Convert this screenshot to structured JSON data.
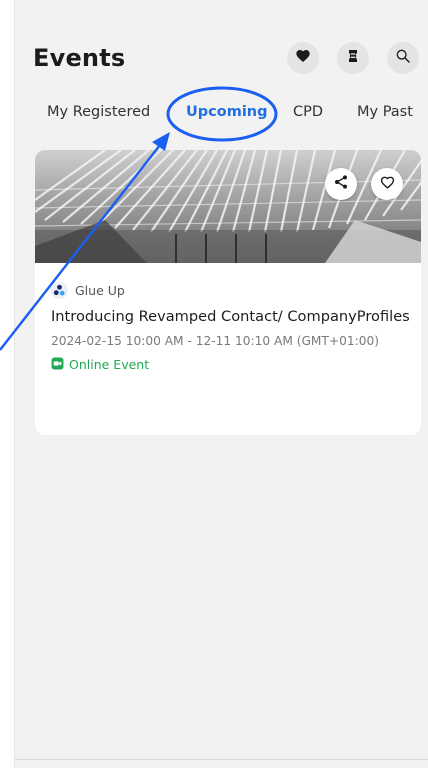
{
  "header": {
    "title": "Events",
    "icons": [
      "heart-icon",
      "ticket-icon",
      "search-icon"
    ]
  },
  "tabs": [
    {
      "label": "My Registered",
      "active": false
    },
    {
      "label": "Upcoming",
      "active": true
    },
    {
      "label": "CPD",
      "active": false
    },
    {
      "label": "My Past",
      "active": false
    }
  ],
  "event": {
    "organizer": "Glue Up",
    "title": "Introducing Revamped Contact/ CompanyProfiles",
    "date": "2024-02-15 10:00 AM - 12-11 10:10 AM (GMT+01:00)",
    "type": "Online Event",
    "actions": [
      "share-icon",
      "favorite-icon"
    ]
  },
  "colors": {
    "accent": "#1f6fe0",
    "annotation": "#1a5ff0",
    "online": "#22a852",
    "background": "#f2f2f3"
  }
}
